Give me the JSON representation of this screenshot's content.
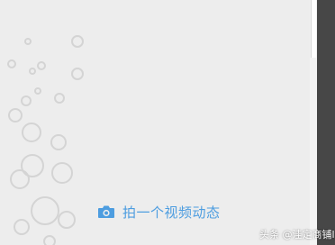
{
  "action": {
    "label": "拍一个视频动态",
    "icon": "camera-icon",
    "accent": "#4d9de0"
  },
  "watermark": {
    "text": "头条 @洼定商铺ly"
  },
  "colors": {
    "background": "#ededed",
    "side_strip": "#474747"
  }
}
